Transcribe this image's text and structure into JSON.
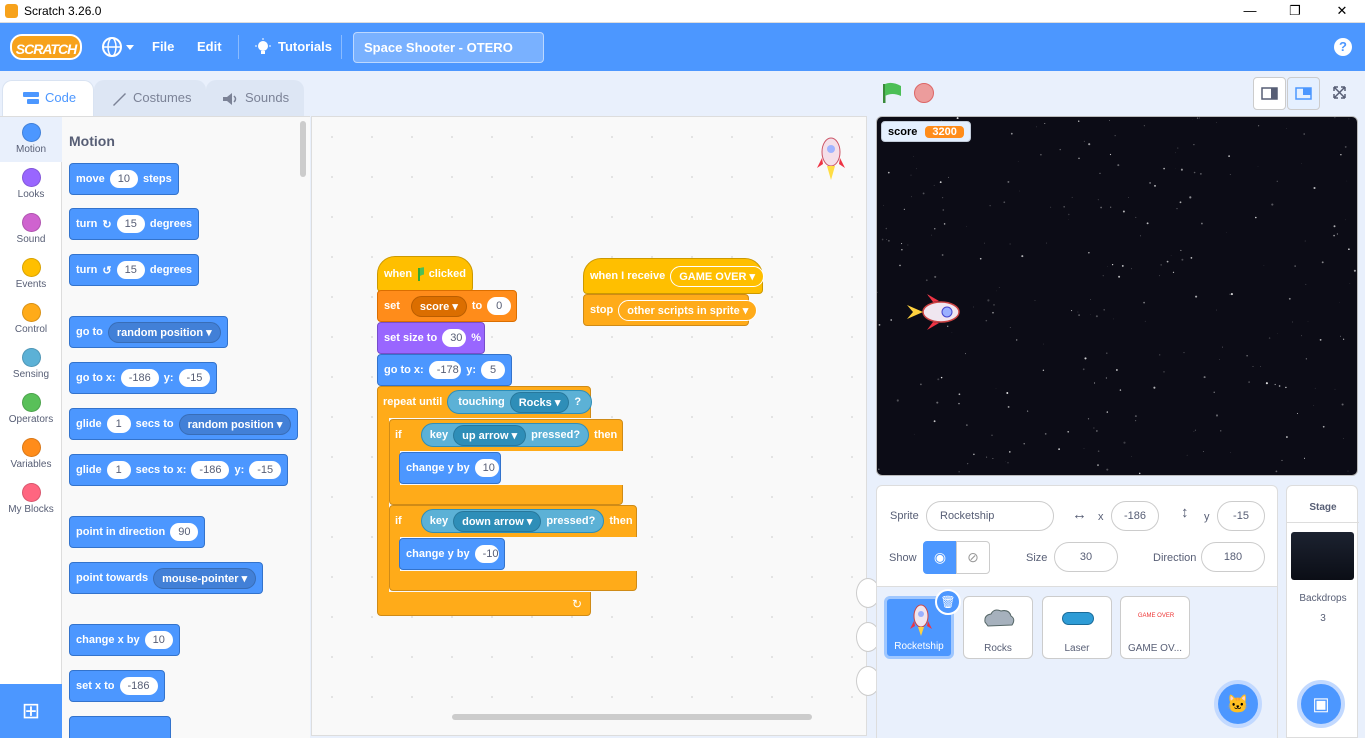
{
  "window": {
    "title": "Scratch 3.26.0",
    "minimize": "—",
    "maximize": "❐",
    "close": "✕"
  },
  "menu": {
    "logo": "SCRATCH",
    "file": "File",
    "edit": "Edit",
    "tutorials": "Tutorials",
    "project_title": "Space Shooter - OTERO",
    "help": "?"
  },
  "tabs": {
    "code": "Code",
    "costumes": "Costumes",
    "sounds": "Sounds"
  },
  "categories": [
    {
      "label": "Motion",
      "color": "#4c97ff"
    },
    {
      "label": "Looks",
      "color": "#9966ff"
    },
    {
      "label": "Sound",
      "color": "#cf63cf"
    },
    {
      "label": "Events",
      "color": "#ffbf00"
    },
    {
      "label": "Control",
      "color": "#ffab19"
    },
    {
      "label": "Sensing",
      "color": "#5cb1d6"
    },
    {
      "label": "Operators",
      "color": "#59c059"
    },
    {
      "label": "Variables",
      "color": "#ff8c1a"
    },
    {
      "label": "My Blocks",
      "color": "#ff6680"
    }
  ],
  "palette": {
    "heading": "Motion",
    "move": {
      "a": "move",
      "v": "10",
      "b": "steps"
    },
    "turn_r": {
      "a": "turn",
      "v": "15",
      "b": "degrees"
    },
    "turn_l": {
      "a": "turn",
      "v": "15",
      "b": "degrees"
    },
    "goto": {
      "a": "go to",
      "dd": "random position"
    },
    "gotoxy": {
      "a": "go to x:",
      "x": "-186",
      "b": "y:",
      "y": "-15"
    },
    "glide": {
      "a": "glide",
      "v": "1",
      "b": "secs to",
      "dd": "random position"
    },
    "glidexy": {
      "a": "glide",
      "v": "1",
      "b": "secs to x:",
      "x": "-186",
      "c": "y:",
      "y": "-15"
    },
    "point": {
      "a": "point in direction",
      "v": "90"
    },
    "towards": {
      "a": "point towards",
      "dd": "mouse-pointer"
    },
    "changex": {
      "a": "change x by",
      "v": "10"
    },
    "setx": {
      "a": "set x to",
      "v": "-186"
    }
  },
  "script1": {
    "when": "when",
    "clicked": "clicked",
    "set": "set",
    "setvar": "score",
    "to": "to",
    "setval": "0",
    "size": "set size to",
    "sizeval": "30",
    "pct": "%",
    "gotox": "go to x:",
    "xval": "-178",
    "y": "y:",
    "yval": "5",
    "repeat": "repeat until",
    "touching": "touching",
    "rocks": "Rocks",
    "q": "?",
    "if1": "if",
    "key1": "key",
    "up": "up arrow",
    "pressed1": "pressed?",
    "then1": "then",
    "chy1": "change y by",
    "chy1v": "10",
    "if2": "if",
    "key2": "key",
    "down": "down arrow",
    "pressed2": "pressed?",
    "then2": "then",
    "chy2": "change y by",
    "chy2v": "-10"
  },
  "script2": {
    "receive": "when I receive",
    "msg": "GAME OVER",
    "stop": "stop",
    "stopdd": "other scripts in sprite"
  },
  "stage": {
    "monitor_label": "score",
    "monitor_value": "3200"
  },
  "sprite_info": {
    "sprite_label": "Sprite",
    "sprite_name": "Rocketship",
    "x_label": "x",
    "x": "-186",
    "y_label": "y",
    "y": "-15",
    "show_label": "Show",
    "size_label": "Size",
    "size": "30",
    "dir_label": "Direction",
    "direction": "180"
  },
  "sprites": [
    {
      "name": "Rocketship"
    },
    {
      "name": "Rocks"
    },
    {
      "name": "Laser"
    },
    {
      "name": "GAME OV..."
    }
  ],
  "gameover_thumb": "GAME OVER",
  "stage_pane": {
    "title": "Stage",
    "backdrops_label": "Backdrops",
    "backdrops_count": "3"
  }
}
